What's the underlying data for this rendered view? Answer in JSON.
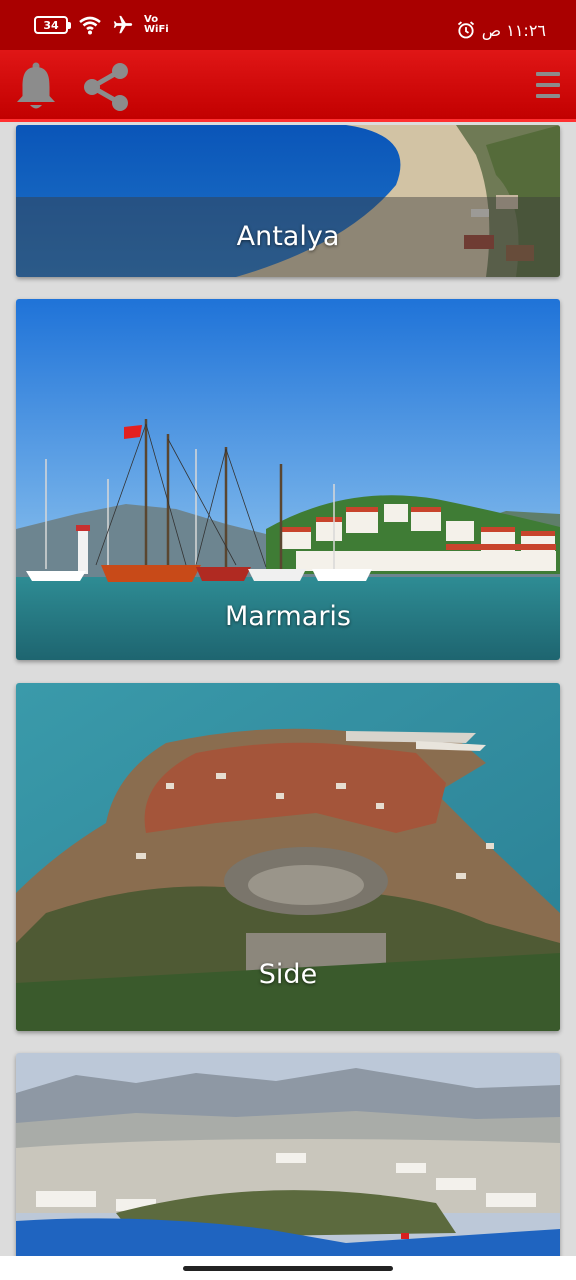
{
  "status_bar": {
    "battery": "34",
    "volte_line1": "Vo",
    "volte_line2": "WiFi",
    "time": "١١:٢٦ ص",
    "icons": [
      "wifi-icon",
      "airplane-icon",
      "alarm-icon"
    ]
  },
  "app_bar": {
    "icons": [
      "bell-icon",
      "share-icon",
      "menu-icon"
    ],
    "color": "#c40000"
  },
  "cards": [
    {
      "title": "Antalya"
    },
    {
      "title": "Marmaris"
    },
    {
      "title": "Side"
    },
    {
      "title": ""
    }
  ]
}
